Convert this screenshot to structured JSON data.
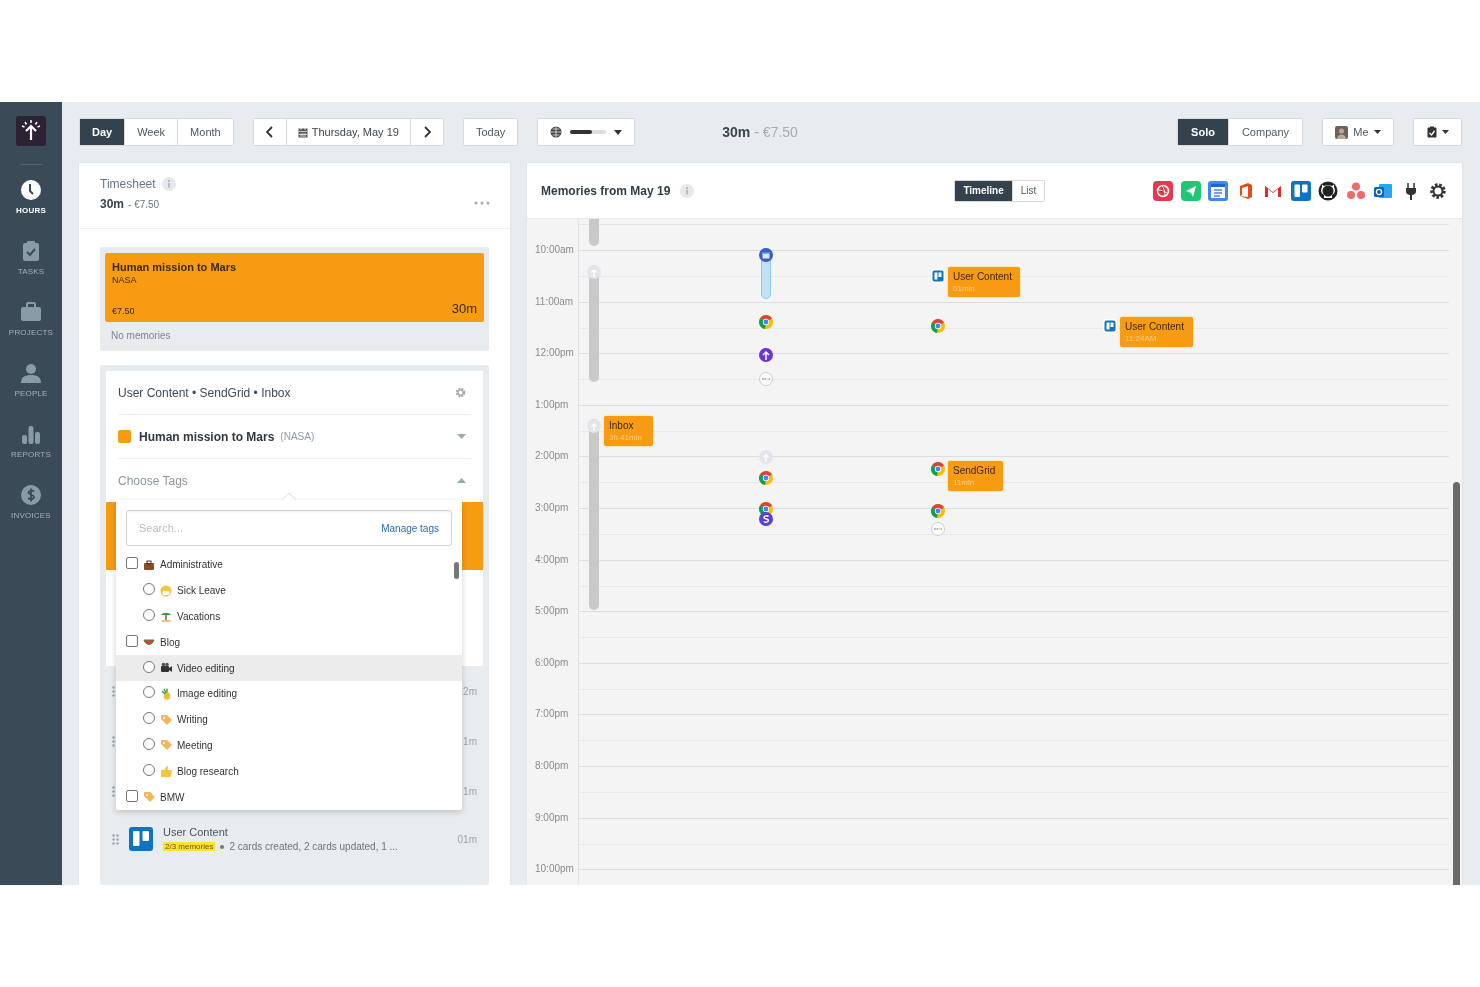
{
  "sidebar": {
    "items": [
      {
        "label": "HOURS",
        "selected": true
      },
      {
        "label": "TASKS",
        "selected": false
      },
      {
        "label": "PROJECTS",
        "selected": false
      },
      {
        "label": "PEOPLE",
        "selected": false
      },
      {
        "label": "REPORTS",
        "selected": false
      },
      {
        "label": "INVOICES",
        "selected": false
      }
    ]
  },
  "toolbar": {
    "view_tabs": [
      {
        "label": "Day",
        "selected": true
      },
      {
        "label": "Week",
        "selected": false
      },
      {
        "label": "Month",
        "selected": false
      }
    ],
    "date": "Thursday, May 19",
    "today": "Today",
    "total": {
      "duration": "30m",
      "amount": "- €7.50"
    },
    "mode_tabs": [
      {
        "label": "Solo",
        "selected": true
      },
      {
        "label": "Company",
        "selected": false
      }
    ],
    "user_menu": "Me"
  },
  "timesheet": {
    "title": "Timesheet",
    "duration": "30m",
    "amount": "- €7.50",
    "entry": {
      "project": "Human mission to Mars",
      "client": "NASA",
      "amount": "€7.50",
      "duration": "30m",
      "memories": "No memories"
    },
    "editor": {
      "summary": "User Content • SendGrid • Inbox",
      "project": "Human mission to Mars",
      "client": "(NASA)",
      "tags_placeholder": "Choose Tags",
      "expanded": true
    },
    "tag_menu": {
      "search_placeholder": "Search...",
      "manage_link": "Manage tags",
      "groups": [
        {
          "label": "Administrative",
          "checked": false,
          "children": [
            {
              "label": "Sick Leave",
              "checked": false,
              "hovered": false
            },
            {
              "label": "Vacations",
              "checked": false,
              "hovered": false
            }
          ]
        },
        {
          "label": "Blog",
          "checked": false,
          "children": [
            {
              "label": "Video editing",
              "checked": false,
              "hovered": true
            },
            {
              "label": "Image editing",
              "checked": false,
              "hovered": false
            },
            {
              "label": "Writing",
              "checked": false,
              "hovered": false
            },
            {
              "label": "Meeting",
              "checked": false,
              "hovered": false
            },
            {
              "label": "Blog research",
              "checked": false,
              "hovered": false
            }
          ]
        },
        {
          "label": "BMW",
          "checked": false
        }
      ]
    },
    "rows": [
      {
        "kind": "covered",
        "duration": "2m"
      },
      {
        "kind": "covered",
        "duration": "1m"
      },
      {
        "kind": "covered",
        "duration": "1m"
      },
      {
        "kind": "memory",
        "title": "User Content",
        "badge": "2/3 memories",
        "details": "2 cards created, 2 cards updated, 1 ...",
        "duration": "01m"
      }
    ]
  },
  "memories": {
    "title": "Memories from May 19",
    "view_tabs": [
      {
        "label": "Timeline",
        "selected": true
      },
      {
        "label": "List",
        "selected": false
      }
    ],
    "hours": [
      "10:00am",
      "11:00am",
      "12:00pm",
      "1:00pm",
      "2:00pm",
      "3:00pm",
      "4:00pm",
      "5:00pm",
      "6:00pm",
      "7:00pm",
      "8:00pm",
      "9:00pm",
      "10:00pm"
    ],
    "cards": [
      {
        "title": "Inbox",
        "subtitle": "3h 41min"
      },
      {
        "title": "User Content",
        "subtitle": "01min"
      },
      {
        "title": "SendGrid",
        "subtitle": "11min"
      },
      {
        "title": "User Content",
        "subtitle": "11:24AM"
      }
    ]
  }
}
